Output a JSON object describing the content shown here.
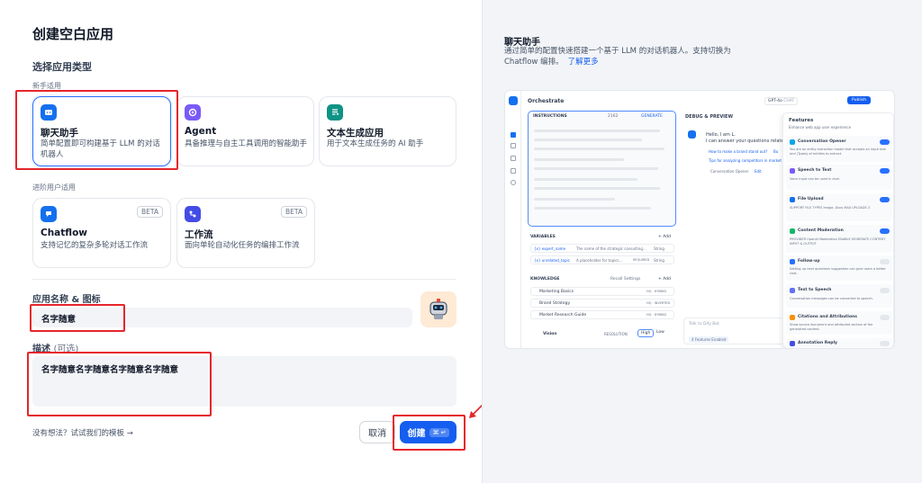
{
  "title": "创建空白应用",
  "type_section": {
    "label": "选择应用类型",
    "beginner_caption": "新手适用",
    "advanced_caption": "进阶用户适用",
    "cards": [
      {
        "icon": "chat-bubble-icon",
        "title": "聊天助手",
        "desc": "简单配置即可构建基于 LLM 的对话机器人",
        "color": "#1570ef",
        "selected": true
      },
      {
        "icon": "agent-icon",
        "title": "Agent",
        "desc": "具备推理与自主工具调用的智能助手",
        "color": "#7a5af8"
      },
      {
        "icon": "text-generation-icon",
        "title": "文本生成应用",
        "desc": "用于文本生成任务的 AI 助手",
        "color": "#0e9384"
      },
      {
        "icon": "chatflow-icon",
        "title": "Chatflow",
        "desc": "支持记忆的复杂多轮对话工作流",
        "badge": "BETA",
        "color": "#1570ef"
      },
      {
        "icon": "workflow-icon",
        "title": "工作流",
        "desc": "面向单轮自动化任务的编排工作流",
        "badge": "BETA",
        "color": "#444ce7"
      }
    ]
  },
  "name_section": {
    "label": "应用名称 & 图标",
    "value": "名字随意"
  },
  "desc_section": {
    "label": "描述",
    "optional": "(可选)",
    "value": "名字随意名字随意名字随意名字随意"
  },
  "footer": {
    "template_link": "没有想法？试试我们的模板",
    "arrow": "→",
    "cancel_label": "取消",
    "create_label": "创建",
    "shortcut": "⌘ ↵"
  },
  "preview": {
    "title": "聊天助手",
    "desc_line1": "通过简单的配置快速搭建一个基于 LLM 的对话机器人。支持切换为",
    "desc_line2": "Chatflow 编排。",
    "learn_more": "了解更多",
    "mock": {
      "header": "Orchestrate",
      "model": "GPT-4o",
      "mode": "CHAT",
      "publish": "Publish",
      "instructions": "INSTRUCTIONS",
      "instructions_count": "2162",
      "generate": "GENERATE",
      "debug": "DEBUG & PREVIEW",
      "greeting1": "Hello, I am L.",
      "greeting2": "I can answer your questions related",
      "q1": "How to make a brand stand out?",
      "q1b": "Bu",
      "q2": "Tips for analyzing competitors in market",
      "opener": "Conversation Opener",
      "edit": "Edit",
      "variables": "VARIABLES",
      "add": "+ Add",
      "vars": [
        {
          "name": "{x} expert_name",
          "desc": "The name of the strategic consulting...",
          "type": "String"
        },
        {
          "name": "{x} unrelated_topic",
          "desc": "A placeholder for topics...",
          "req": "REQUIRED",
          "type": "String"
        }
      ],
      "knowledge": "KNOWLEDGE",
      "recall": "Recall Settings",
      "docs": [
        {
          "name": "Marketing Basics",
          "meta": "HQ · HYBRID"
        },
        {
          "name": "Brand Strategy",
          "meta": "HQ · INVERTED"
        },
        {
          "name": "Market Research Guide",
          "meta": "HQ · HYBRID"
        }
      ],
      "vision": "Vision",
      "resolution": "RESOLUTION",
      "high": "High",
      "low": "Low",
      "talk": "Talk to Dify Bot",
      "features_enabled": "4 Features Enabled",
      "features_title": "Features",
      "features_sub": "Enhance web app user experience",
      "features": [
        {
          "name": "Conversation Opener",
          "desc": "You are an entity extraction model that accepts an input text and (Types) of entities to extract.",
          "on": true,
          "color": "#0ba5ec"
        },
        {
          "name": "Speech to Text",
          "desc": "Voice input can be used in chat.",
          "on": true,
          "color": "#7a5af8"
        },
        {
          "name": "File Upload",
          "desc": "SUPPORT FILE TYPES  Image, Docs   MAX UPLOADS 3",
          "on": true,
          "color": "#1570ef"
        },
        {
          "name": "Content Moderation",
          "desc": "PROVIDER OpenAI Moderation   ENABLE MODERATE CONTENT INPUT & OUTPUT",
          "on": true,
          "color": "#12b76a"
        },
        {
          "name": "Follow-up",
          "desc": "Setting up next questions suggestion can give users a better chat.",
          "on": false,
          "color": "#2970ff"
        },
        {
          "name": "Text to Speech",
          "desc": "Conversation messages can be converted to speech.",
          "on": false,
          "color": "#6172f3"
        },
        {
          "name": "Citations and Attributions",
          "desc": "Show source document and attributed section of the generated content.",
          "on": false,
          "color": "#f79009"
        },
        {
          "name": "Annotation Reply",
          "desc": "",
          "on": false,
          "color": "#444ce7"
        }
      ]
    }
  },
  "colors": {
    "accent": "#155eef",
    "highlight": "#e5262b"
  }
}
